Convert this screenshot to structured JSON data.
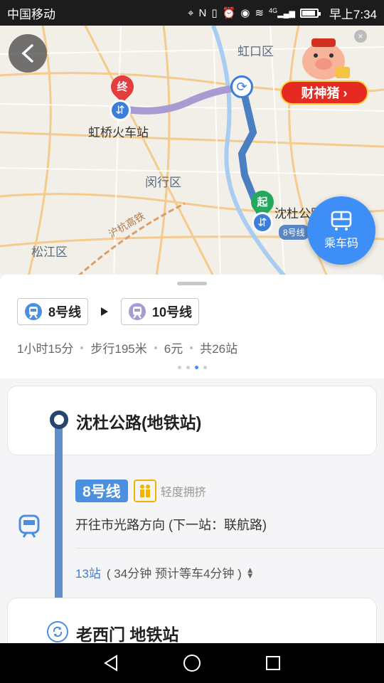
{
  "status_bar": {
    "carrier": "中国移动",
    "network": "4G",
    "time": "早上7:34"
  },
  "map": {
    "labels": {
      "hongkou": "虹口区",
      "minhang": "闵行区",
      "songjiang": "松江区",
      "hongqiao": "虹桥火车站",
      "shendu": "沈杜公路",
      "railway": "沪杭高铁",
      "line8_tag": "8号线"
    },
    "end_marker": "终",
    "start_marker": "起",
    "promo": {
      "label": "财神猪 ›"
    },
    "qr_button": {
      "label": "乘车码"
    }
  },
  "route_summary": {
    "lines": [
      {
        "name": "8号线",
        "color": "#4a8fe0"
      },
      {
        "name": "10号线",
        "color": "#a79bd2"
      }
    ],
    "meta": [
      "1小时15分",
      "步行195米",
      "6元",
      "共26站"
    ],
    "pager_active_index": 2
  },
  "steps": {
    "start_station": "沈杜公路(地铁站)",
    "segment": {
      "line": "8号线",
      "crowd": "轻度拥挤",
      "direction": "开往市光路方向 (下一站：联航路)",
      "stop_count": "13站",
      "detail": "( 34分钟 预计等车4分钟 )"
    },
    "transfer_station": "老西门 地铁站"
  },
  "colors": {
    "accent_blue": "#3d8ff7",
    "line8": "#4a8fe0",
    "line10": "#a79bd2"
  }
}
